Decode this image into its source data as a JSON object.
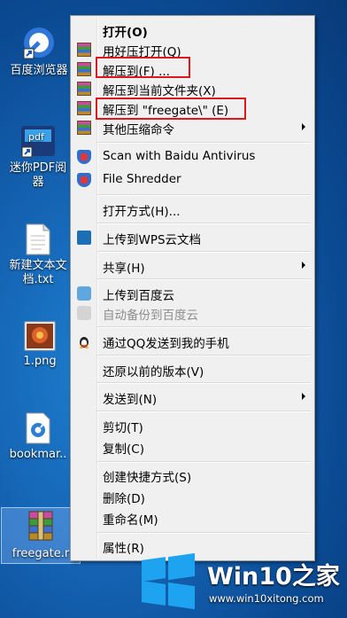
{
  "desktop": {
    "icons": [
      {
        "label": "百度浏览器"
      },
      {
        "label": "迷你PDF阅\n器"
      },
      {
        "label": "新建文本文\n档.txt"
      },
      {
        "label": "1.png"
      },
      {
        "label": "bookmar.."
      },
      {
        "label": "freegate.r"
      }
    ]
  },
  "menu": {
    "items": [
      {
        "label": "打开(O)"
      },
      {
        "label": "用好压打开(Q)"
      },
      {
        "label": "解压到(F) ..."
      },
      {
        "label": "解压到当前文件夹(X)"
      },
      {
        "label": "解压到 \"freegate\\\" (E)"
      },
      {
        "label": "其他压缩命令"
      },
      {
        "label": "Scan with Baidu Antivirus"
      },
      {
        "label": "File Shredder"
      },
      {
        "label": "打开方式(H)..."
      },
      {
        "label": "上传到WPS云文档"
      },
      {
        "label": "共享(H)"
      },
      {
        "label": "上传到百度云"
      },
      {
        "label": "自动备份到百度云"
      },
      {
        "label": "通过QQ发送到我的手机"
      },
      {
        "label": "还原以前的版本(V)"
      },
      {
        "label": "发送到(N)"
      },
      {
        "label": "剪切(T)"
      },
      {
        "label": "复制(C)"
      },
      {
        "label": "创建快捷方式(S)"
      },
      {
        "label": "删除(D)"
      },
      {
        "label": "重命名(M)"
      },
      {
        "label": "属性(R)"
      }
    ]
  },
  "watermark": {
    "brand": "Win10",
    "brand_suffix": "之家",
    "url": "www.win10xitong.com"
  },
  "colors": {
    "highlight_border": "#e0161b",
    "win_blue": "#1ea3f1"
  }
}
